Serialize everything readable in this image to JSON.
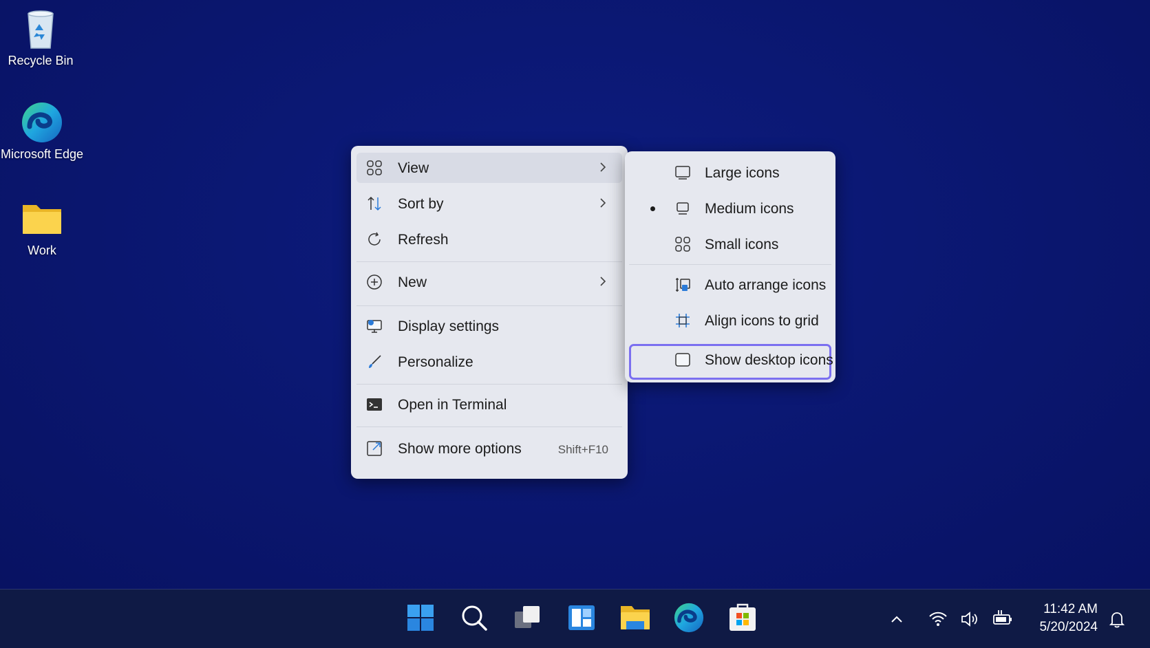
{
  "desktop": {
    "icons": [
      {
        "label": "Recycle Bin",
        "icon": "recycle-bin-icon"
      },
      {
        "label": "Microsoft Edge",
        "icon": "edge-icon"
      },
      {
        "label": "Work",
        "icon": "folder-icon"
      }
    ]
  },
  "context_menu": {
    "items": [
      {
        "label": "View",
        "icon": "grid-icon",
        "has_submenu": true
      },
      {
        "label": "Sort by",
        "icon": "sort-icon",
        "has_submenu": true
      },
      {
        "label": "Refresh",
        "icon": "refresh-icon"
      },
      {
        "label": "New",
        "icon": "plus-circle-icon",
        "has_submenu": true
      },
      {
        "label": "Display settings",
        "icon": "display-icon"
      },
      {
        "label": "Personalize",
        "icon": "brush-icon"
      },
      {
        "label": "Open in Terminal",
        "icon": "terminal-icon"
      },
      {
        "label": "Show more options",
        "icon": "share-icon",
        "shortcut": "Shift+F10"
      }
    ]
  },
  "view_submenu": {
    "items": [
      {
        "label": "Large icons",
        "icon": "monitor-icon",
        "selected": false
      },
      {
        "label": "Medium icons",
        "icon": "monitor-icon",
        "selected": true
      },
      {
        "label": "Small icons",
        "icon": "grid-icon",
        "selected": false
      },
      {
        "label": "Auto arrange icons",
        "icon": "auto-arrange-icon"
      },
      {
        "label": "Align icons to grid",
        "icon": "align-grid-icon"
      },
      {
        "label": "Show desktop icons",
        "icon": "checkbox-icon",
        "checked": false
      }
    ]
  },
  "taskbar": {
    "apps": [
      "start-icon",
      "search-icon",
      "task-view-icon",
      "widgets-icon",
      "file-explorer-icon",
      "edge-icon",
      "store-icon"
    ],
    "time": "11:42 AM",
    "date": "5/20/2024"
  },
  "colors": {
    "desktop_bg": "#0a1670",
    "menu_bg": "#e6e8ef",
    "focus_outline": "#7b6ff0",
    "accent_blue": "#2a7ad8"
  }
}
